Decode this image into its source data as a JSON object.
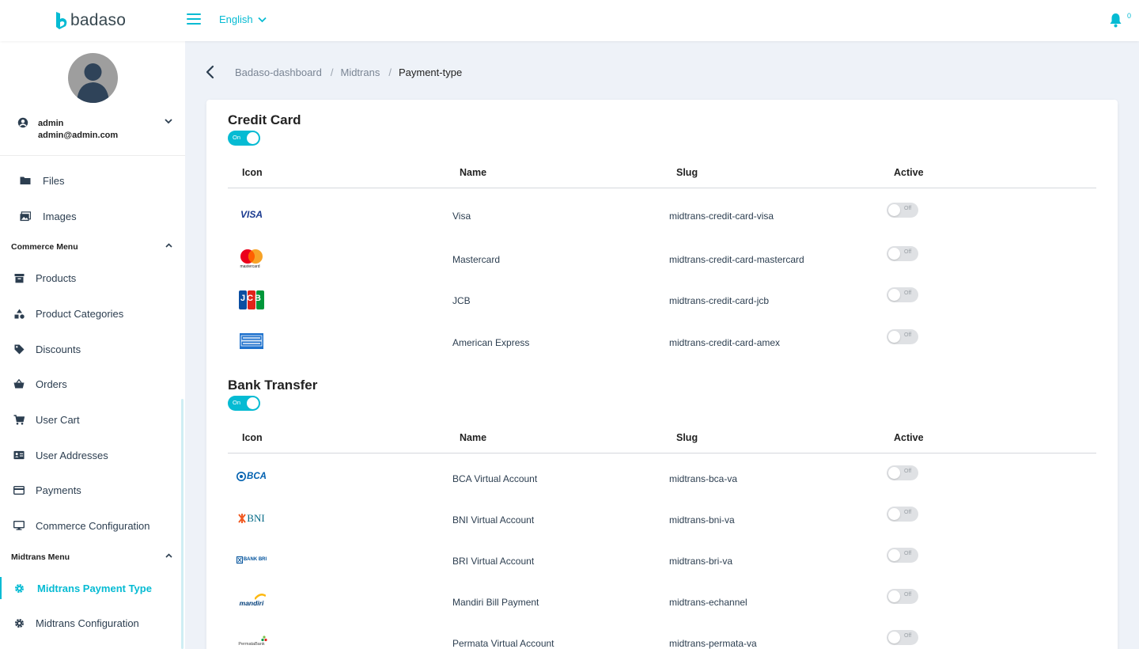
{
  "app": {
    "logo_text": "badaso"
  },
  "header": {
    "language": "English",
    "notification_count": "0"
  },
  "user": {
    "name": "admin",
    "email": "admin@admin.com"
  },
  "sidebar": {
    "items_top": [
      {
        "label": "Files",
        "icon": "folder-icon"
      },
      {
        "label": "Images",
        "icon": "images-icon"
      }
    ],
    "commerce_menu": {
      "title": "Commerce Menu",
      "items": [
        {
          "label": "Products",
          "icon": "archive-icon"
        },
        {
          "label": "Product Categories",
          "icon": "shapes-icon"
        },
        {
          "label": "Discounts",
          "icon": "tag-icon"
        },
        {
          "label": "Orders",
          "icon": "basket-icon"
        },
        {
          "label": "User Cart",
          "icon": "cart-icon"
        },
        {
          "label": "User Addresses",
          "icon": "address-card-icon"
        },
        {
          "label": "Payments",
          "icon": "credit-card-icon"
        },
        {
          "label": "Commerce Configuration",
          "icon": "desktop-icon"
        }
      ]
    },
    "midtrans_menu": {
      "title": "Midtrans Menu",
      "items": [
        {
          "label": "Midtrans Payment Type",
          "icon": "gear-icon",
          "active": true
        },
        {
          "label": "Midtrans Configuration",
          "icon": "gear-icon",
          "active": false
        }
      ]
    }
  },
  "breadcrumb": {
    "items": [
      "Badaso-dashboard",
      "Midtrans"
    ],
    "current": "Payment-type"
  },
  "table_headers": {
    "icon": "Icon",
    "name": "Name",
    "slug": "Slug",
    "active": "Active"
  },
  "switch_labels": {
    "on": "On",
    "off": "Off"
  },
  "sections": [
    {
      "title": "Credit Card",
      "enabled": true,
      "rows": [
        {
          "icon": "visa-logo",
          "name": "Visa",
          "slug": "midtrans-credit-card-visa",
          "active": false
        },
        {
          "icon": "mastercard-logo",
          "name": "Mastercard",
          "slug": "midtrans-credit-card-mastercard",
          "active": false
        },
        {
          "icon": "jcb-logo",
          "name": "JCB",
          "slug": "midtrans-credit-card-jcb",
          "active": false
        },
        {
          "icon": "amex-logo",
          "name": "American Express",
          "slug": "midtrans-credit-card-amex",
          "active": false
        }
      ]
    },
    {
      "title": "Bank Transfer",
      "enabled": true,
      "rows": [
        {
          "icon": "bca-logo",
          "name": "BCA Virtual Account",
          "slug": "midtrans-bca-va",
          "active": false
        },
        {
          "icon": "bni-logo",
          "name": "BNI Virtual Account",
          "slug": "midtrans-bni-va",
          "active": false
        },
        {
          "icon": "bri-logo",
          "name": "BRI Virtual Account",
          "slug": "midtrans-bri-va",
          "active": false
        },
        {
          "icon": "mandiri-logo",
          "name": "Mandiri Bill Payment",
          "slug": "midtrans-echannel",
          "active": false
        },
        {
          "icon": "permata-logo",
          "name": "Permata Virtual Account",
          "slug": "midtrans-permata-va",
          "active": false
        }
      ]
    }
  ],
  "logo_text": {
    "visa": "VISA",
    "mastercard": "mastercard",
    "jcb": "JCB",
    "bca": "BCA",
    "bni": "BNI",
    "mandiri": "mandiri",
    "permata": "PermataBank",
    "bri": "BANK BRI"
  },
  "colors": {
    "accent": "#06bbd3",
    "switch_off": "#dfe1e4"
  }
}
